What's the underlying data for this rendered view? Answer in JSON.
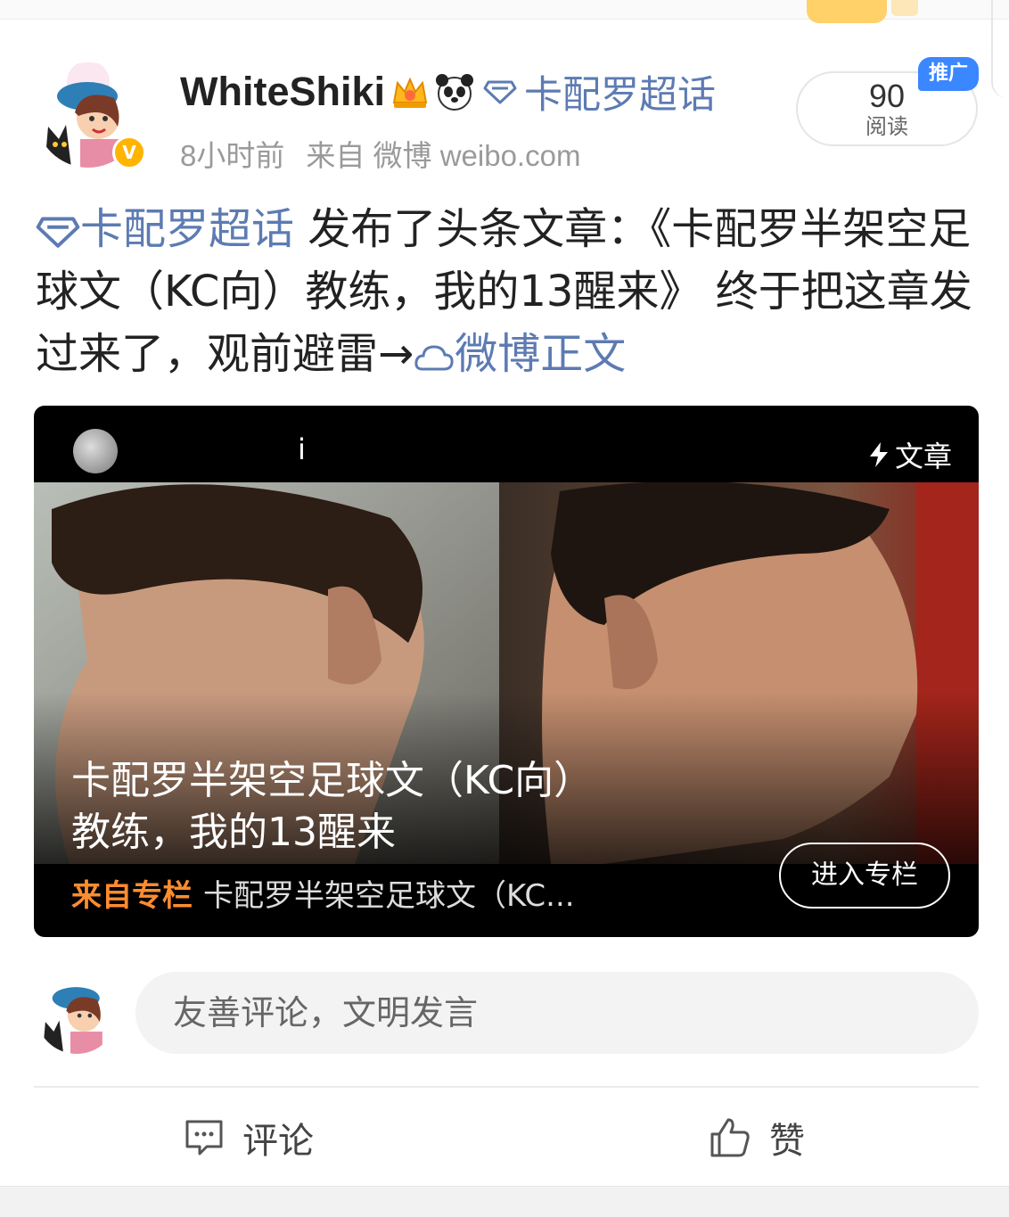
{
  "post": {
    "username": "WhiteShiki",
    "topic_name": "卡配罗超话",
    "time": "8小时前",
    "source": "来自 微博 weibo.com",
    "reads_count": "90",
    "reads_label": "阅读",
    "promo_label": "推广",
    "text_topic": "卡配罗超话",
    "text_body": " 发布了头条文章：《卡配罗半架空足球文（KC向）教练，我的13醒来》 终于把这章发过来了，观前避雷→",
    "text_link": "微博正文"
  },
  "card": {
    "author_visible": "i",
    "type_label": "文章",
    "title": "卡配罗半架空足球文（KC向）教练，我的13醒来",
    "from_label": "来自专栏",
    "column_name": "卡配罗半架空足球文（KC...",
    "enter_button": "进入专栏"
  },
  "comment": {
    "placeholder": "友善评论，文明发言"
  },
  "actions": {
    "comment_label": "评论",
    "like_label": "赞"
  },
  "icons": {
    "topic": "diamond-icon",
    "link": "cloud-icon",
    "type": "lightning-icon",
    "comment": "comment-icon",
    "like": "thumbs-up-icon",
    "crown": "crown-emoji-icon",
    "panda": "panda-emoji-icon",
    "verified": "verified-badge-icon"
  },
  "colors": {
    "link_blue": "#5d7bb2",
    "promo_blue": "#3a87ff",
    "column_orange": "#ff8c2e",
    "verified_yellow": "#ffb400"
  }
}
